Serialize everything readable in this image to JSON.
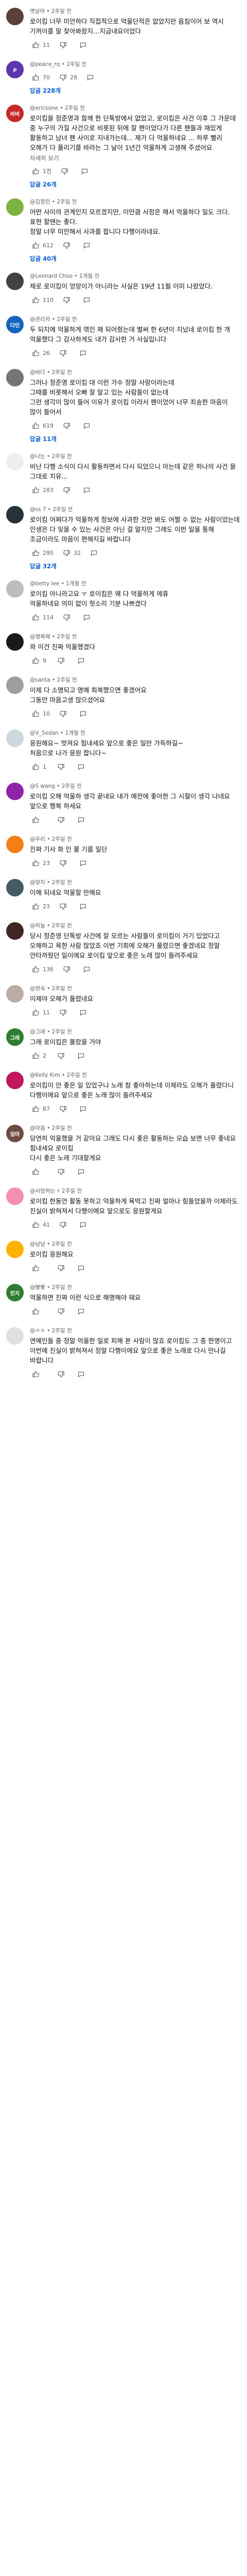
{
  "labels": {
    "more": "자세히 보기",
    "reply_icon": "reply-icon"
  },
  "comments": [
    {
      "author": "옛날아 • 2주일 전",
      "text": "로이킴 너무 미안하다 직접적으로 억울단적은 없었지만 음침이어 보 역시 기꺼이를 말 찾아봐왔지…지금내요이었다",
      "more": "",
      "likes": "11",
      "replies": "",
      "avatar": {
        "color": "#5d4037",
        "label": ""
      }
    },
    {
      "author": "@peace_rq • 2주일 전",
      "text": "",
      "more": "",
      "likes": "70",
      "dislikes": "28",
      "replies": "답글 228개",
      "avatar": {
        "color": "#5e35b1",
        "label": "p"
      }
    },
    {
      "author": "@ericsone • 2주일 전",
      "text": "로이킴을 정준영과 함께 한 단톡방에서 없었고, 로이킴은 사건 이후 그 가운데 중 누구의 가질 사건으로 비롯된 뒤에 잘 팬이었다가 다른 팬들과 재밌게 활동하고 남녀 팬 사이로 지내가는데... 제가 다 억울하네요 ... 하루 빨리 오해가 다 풀리기를 바라는 그 날이 1년간 억울하게 고생해 주셨어요",
      "more": "자세히 보기",
      "likes": "1천",
      "replies": "답글 26개",
      "avatar": {
        "color": "#c62828",
        "label": "비버"
      }
    },
    {
      "author": "@김정민 • 2주일 전",
      "text": "어떤 사이의 관계인지 모르겠지만, 이만큼 사정은 해서 억울하다 일도 크다. 표현 할땐는 좋다.\n정말 너무 미안해서 사과를 합니다 다행이라네요.",
      "more": "",
      "likes": "612",
      "replies": "답글 40개",
      "avatar": {
        "color": "#7cb342",
        "label": ""
      }
    },
    {
      "author": "@Leonard Choo • 1개월 전",
      "text": "제로 로이킴이 엉망이가 아니라는 사실은 19년 11월 이미 나왔었다.",
      "more": "",
      "likes": "110",
      "replies": "",
      "avatar": {
        "color": "#424242",
        "label": ""
      }
    },
    {
      "author": "@관리자 • 2주일 전",
      "text": "두 되지에 억울하게 엮인 채 되어줬는데 벌써 한 6년이 지났네 로이킴 한 개 억울했다 그 감사하게도 내가 감사한 거 사실입니다",
      "more": "",
      "likes": "26",
      "replies": "",
      "avatar": {
        "color": "#1565c0",
        "label": "다인"
      }
    },
    {
      "author": "@바다 • 2주일 전",
      "text": "그러나 정준영 로이킴 대 이런 가수 정말 사랑이라는데\n그때를 비롯해서 오빠 잘 알고 있는 사람들이 없는데\n그런 생각이 많이 들어 이유가 로이킴 이라서 팬이었어 너무 죄송한 마음이 많이 들어서",
      "more": "",
      "likes": "619",
      "replies": "답글 11개",
      "avatar": {
        "color": "#757575",
        "label": ""
      }
    },
    {
      "author": "@나는 • 2주일 전",
      "text": "비난 다행 소식이 다시 활동하면서 다시 되었으니 아는데 같은 하나의 사건 을 그대로 치유...",
      "more": "",
      "likes": "283",
      "replies": "",
      "avatar": {
        "color": "#eeeeee",
        "label": ""
      }
    },
    {
      "author": "@ss 7 • 2주일 전",
      "text": "로이킴 어쩌다가 억울하게 정보에 사과한 것만 봐도 어쩔 수 없는 사람이었는데 인생은 다 잊을 수 있는 사건은 아닌 걸 알지만 그래도 이번 일을 통해 조금이라도 마음이 편해지길 바랍니다",
      "more": "",
      "likes": "295",
      "dislikes": "32",
      "replies": "답글 32개",
      "avatar": {
        "color": "#263238",
        "label": ""
      }
    },
    {
      "author": "@betty lee • 1개월 전",
      "text": "로이킴 아니라고요 ㅜ 로이킴은 왜 다 억울하게 에휴\n억울하네요 의미 없이 헛소리 기분 나쁘겠다",
      "more": "",
      "likes": "114",
      "replies": "",
      "avatar": {
        "color": "#bdbdbd",
        "label": ""
      }
    },
    {
      "author": "@행복해 • 2주일 전",
      "text": "와 이건 진짜 억울했겠다",
      "more": "",
      "likes": "9",
      "replies": "",
      "avatar": {
        "color": "#1a1a1a",
        "label": ""
      }
    },
    {
      "author": "@santa • 2주일 전",
      "text": "이제 다 소명되고 명예 회복했으면 좋겠어요\n그동안 마음고생 많으셨어요",
      "more": "",
      "likes": "10",
      "replies": "",
      "avatar": {
        "color": "#9e9e9e",
        "label": ""
      }
    },
    {
      "author": "@V_Sedan • 1개월 전",
      "text": "응원해요~ 멋져요 힘내세요 앞으로 좋은 일만 가득하길~\n처음으로 나가 응원 합니다~",
      "more": "",
      "likes": "1",
      "replies": "",
      "avatar": {
        "color": "#cfd8dc",
        "label": ""
      }
    },
    {
      "author": "@S wang • 2주일 전",
      "text": "로이킴 오해 억울하 생각 끝내요 내가 예전에 좋아한 그 시절이 생각 나네요 앞으로 행복 하세요",
      "more": "",
      "likes": "",
      "replies": "",
      "avatar": {
        "color": "#8e24aa",
        "label": ""
      }
    },
    {
      "author": "@우리 • 2주일 전",
      "text": "진짜 기사 화 인 물 기름 일단",
      "more": "",
      "likes": "23",
      "replies": "",
      "avatar": {
        "color": "#f57f17",
        "label": ""
      }
    },
    {
      "author": "@양지 • 2주일 전",
      "text": "이해 되네요 억울할 만해요",
      "more": "",
      "likes": "23",
      "replies": "",
      "avatar": {
        "color": "#455a64",
        "label": ""
      }
    },
    {
      "author": "@하늘 • 2주일 전",
      "text": "당시 정준영 단톡방 사건에 잘 모르는 사람들이 로이킴이 거기 있었다고 오해하고 욕한 사람 많았죠 이번 기회에 오해가 풀렸으면 좋겠네요 정말 안타까웠던 일이에요 로이킴 앞으로 좋은 노래 많이 들려주세요",
      "more": "",
      "likes": "136",
      "replies": "",
      "avatar": {
        "color": "#3e2723",
        "label": ""
      }
    },
    {
      "author": "@현숙 • 2주일 전",
      "text": "이제야 오해가 풀렸네요",
      "more": "",
      "likes": "11",
      "replies": "",
      "avatar": {
        "color": "#bcaaa4",
        "label": ""
      }
    },
    {
      "author": "@그래 • 2주일 전",
      "text": "그래 로이킴은 몰랐을 거야",
      "more": "",
      "likes": "2",
      "replies": "",
      "avatar": {
        "color": "#2e7d32",
        "label": "그래"
      }
    },
    {
      "author": "@Kelly Kim • 2주일 전",
      "text": "로이킴이 안 좋은 일 있었구나 노래 참 좋아하는데 이제라도 오해가 풀렸다니 다행이에요 앞으로 좋은 노래 많이 들려주세요",
      "more": "",
      "likes": "87",
      "replies": "",
      "avatar": {
        "color": "#c2185b",
        "label": ""
      }
    },
    {
      "author": "@마음 • 2주일 전",
      "text": "당연히 억울했을 거 같아요 그래도 다시 좋은 활동하는 모습 보면 너무 좋네요\n힘내세요 로이킴\n다시 좋은 노래 기대할게요",
      "more": "",
      "likes": "",
      "replies": "",
      "avatar": {
        "color": "#6d4c41",
        "label": "엄마"
      }
    },
    {
      "author": "@사랑하는 • 2주일 전",
      "text": "로이킴 한동안 활동 못하고 억울하게 욕먹고 진짜 얼마나 힘들었을까 이제라도 진실이 밝혀져서 다행이에요 앞으로도 응원할게요",
      "more": "",
      "likes": "41",
      "replies": "",
      "avatar": {
        "color": "#f48fb1",
        "label": ""
      }
    },
    {
      "author": "@냠냠 • 2주일 전",
      "text": "로이킴 응원해요",
      "more": "",
      "likes": "",
      "replies": "",
      "avatar": {
        "color": "#ffb300",
        "label": ""
      }
    },
    {
      "author": "@빵빵 • 2주일 전",
      "text": "억울하면 진짜 이런 식으로 해명해야 돼요",
      "more": "",
      "likes": "",
      "replies": "",
      "avatar": {
        "color": "#2e7d32",
        "label": "민지"
      }
    },
    {
      "author": "@ㅇㅇ • 2주일 전",
      "text": "연예인들 중 정말 억울한 일로 피해 본 사람이 많죠 로이킴도 그 중 한명이고 이번에 진실이 밝혀져서 정말 다행이에요 앞으로 좋은 노래로 다시 만나길 바랍니다",
      "more": "",
      "likes": "",
      "replies": "",
      "avatar": {
        "color": "#e0e0e0",
        "label": ""
      }
    }
  ]
}
